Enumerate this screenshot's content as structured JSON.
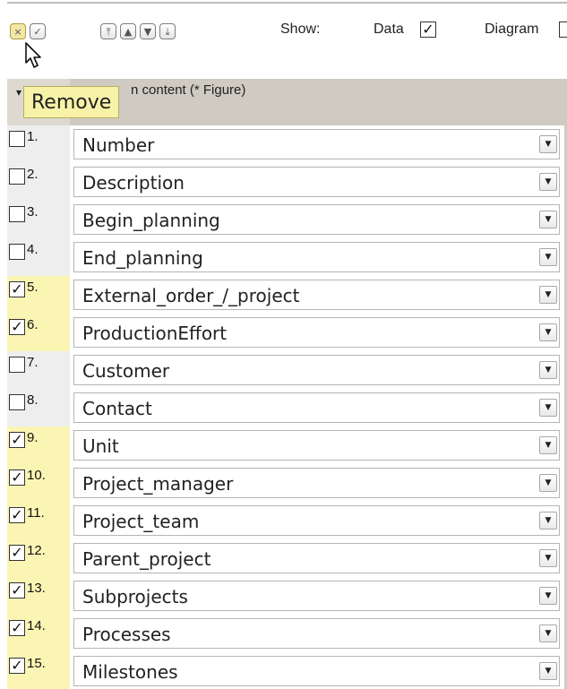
{
  "toolbar": {
    "show_label": "Show:",
    "data_label": "Data",
    "data_checked": "✓",
    "diagram_label": "Diagram",
    "buttons": [
      {
        "icon": "close-icon",
        "glyph": "×"
      },
      {
        "icon": "check-icon",
        "glyph": "✓"
      },
      {
        "icon": "move-to-top-icon",
        "glyph": "⤒"
      },
      {
        "icon": "move-up-icon",
        "glyph": "▲"
      },
      {
        "icon": "move-down-icon",
        "glyph": "▼"
      },
      {
        "icon": "move-to-bottom-icon",
        "glyph": "⤓"
      }
    ]
  },
  "tooltip": {
    "text": "Remove"
  },
  "header": {
    "arrow": "▾",
    "visible_text": "n content (* Figure)"
  },
  "rows": [
    {
      "num": "1.",
      "value": "Number",
      "checked": false
    },
    {
      "num": "2.",
      "value": "Description",
      "checked": false
    },
    {
      "num": "3.",
      "value": "Begin_planning",
      "checked": false
    },
    {
      "num": "4.",
      "value": "End_planning",
      "checked": false
    },
    {
      "num": "5.",
      "value": "External_order_/_project",
      "checked": true
    },
    {
      "num": "6.",
      "value": "ProductionEffort",
      "checked": true
    },
    {
      "num": "7.",
      "value": "Customer",
      "checked": false
    },
    {
      "num": "8.",
      "value": "Contact",
      "checked": false
    },
    {
      "num": "9.",
      "value": "Unit",
      "checked": true
    },
    {
      "num": "10.",
      "value": "Project_manager",
      "checked": true
    },
    {
      "num": "11.",
      "value": "Project_team",
      "checked": true
    },
    {
      "num": "12.",
      "value": "Parent_project",
      "checked": true
    },
    {
      "num": "13.",
      "value": "Subprojects",
      "checked": true
    },
    {
      "num": "14.",
      "value": "Processes",
      "checked": true
    },
    {
      "num": "15.",
      "value": "Milestones",
      "checked": true
    }
  ],
  "colors": {
    "checked_row_bg": "#fbf5b4",
    "unchecked_row_bg": "#eeeeee",
    "header_bg": "#cfcbc2",
    "tooltip_bg": "#f7f2a8"
  }
}
